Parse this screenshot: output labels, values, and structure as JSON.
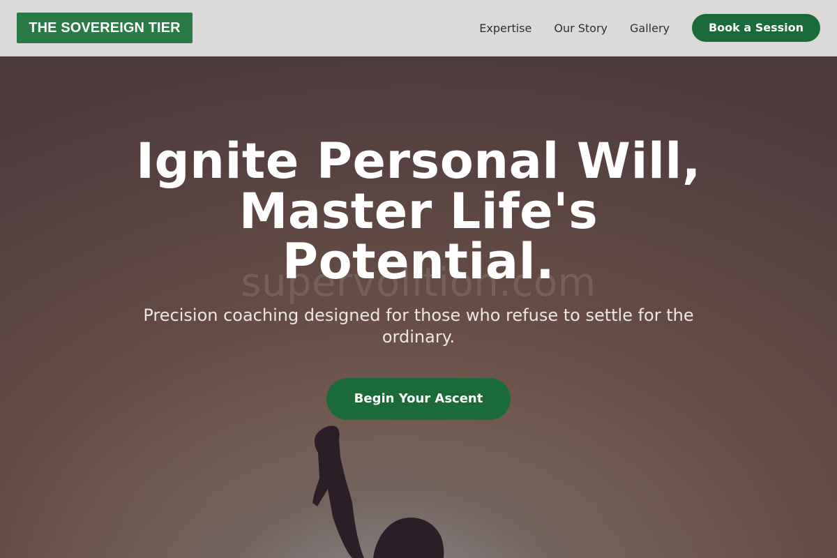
{
  "header": {
    "brand": "THE SOVEREIGN TIER",
    "nav": {
      "expertise": "Expertise",
      "our_story": "Our Story",
      "gallery": "Gallery"
    },
    "cta": "Book a Session"
  },
  "hero": {
    "title": "Ignite Personal Will, Master Life's Potential.",
    "watermark": "supervolition.com",
    "subtitle": "Precision coaching designed for those who refuse to settle for the ordinary.",
    "cta": "Begin Your Ascent",
    "image_icon": "raised-fist-silhouette-icon"
  },
  "colors": {
    "header_bg": "#dcdad9",
    "brand_bg": "#2a7a45",
    "accent": "#1b6b3a",
    "hero_bg": "#5a4442",
    "silhouette": "#2b1e26"
  }
}
